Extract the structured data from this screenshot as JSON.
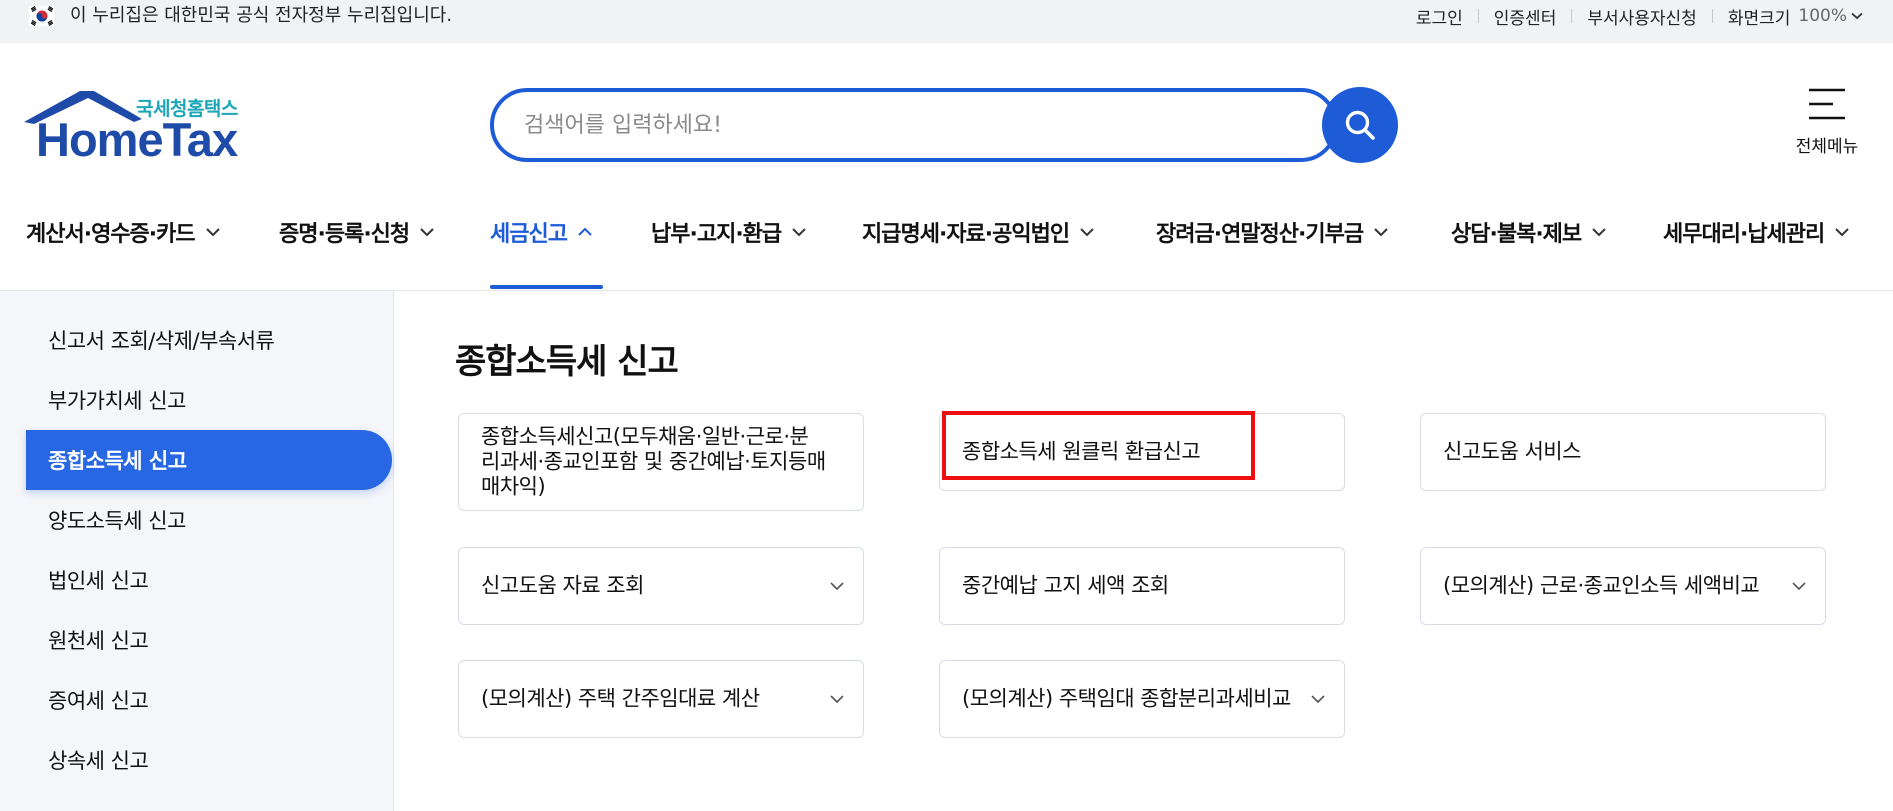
{
  "gov_banner": {
    "text": "이 누리집은 대한민국 공식 전자정부 누리집입니다.",
    "flag_icon": "korea-flag-icon",
    "links": [
      "로그인",
      "인증센터",
      "부서사용자신청"
    ],
    "zoom_label": "화면크기",
    "zoom_value": "100%"
  },
  "header": {
    "logo_sub": "국세청홈택스",
    "logo_main": "HomeTax",
    "search_placeholder": "검색어를 입력하세요!",
    "search_icon": "search-icon",
    "all_menu_label": "전체메뉴"
  },
  "gnb": {
    "items": [
      {
        "label": "계산서·영수증·카드",
        "active": false
      },
      {
        "label": "증명·등록·신청",
        "active": false
      },
      {
        "label": "세금신고",
        "active": true
      },
      {
        "label": "납부·고지·환급",
        "active": false
      },
      {
        "label": "지급명세·자료·공익법인",
        "active": false
      },
      {
        "label": "장려금·연말정산·기부금",
        "active": false
      },
      {
        "label": "상담·불복·제보",
        "active": false
      },
      {
        "label": "세무대리·납세관리",
        "active": false
      }
    ]
  },
  "sidebar": {
    "items": [
      {
        "label": "신고서 조회/삭제/부속서류",
        "active": false
      },
      {
        "label": "부가가치세 신고",
        "active": false
      },
      {
        "label": "종합소득세 신고",
        "active": true
      },
      {
        "label": "양도소득세 신고",
        "active": false
      },
      {
        "label": "법인세 신고",
        "active": false
      },
      {
        "label": "원천세 신고",
        "active": false
      },
      {
        "label": "증여세 신고",
        "active": false
      },
      {
        "label": "상속세 신고",
        "active": false
      }
    ]
  },
  "content": {
    "title": "종합소득세 신고",
    "cards": [
      {
        "label": "종합소득세신고(모두채움·일반·근로·분리과세·종교인포함 및 중간예납·토지등매매차익)",
        "dropdown": false
      },
      {
        "label": "종합소득세 원클릭 환급신고",
        "dropdown": false,
        "highlighted": true
      },
      {
        "label": "신고도움 서비스",
        "dropdown": false
      },
      {
        "label": "신고도움 자료 조회",
        "dropdown": true
      },
      {
        "label": "중간예납 고지 세액 조회",
        "dropdown": false
      },
      {
        "label": "(모의계산) 근로·종교인소득 세액비교",
        "dropdown": true
      },
      {
        "label": "(모의계산) 주택 간주임대료 계산",
        "dropdown": true
      },
      {
        "label": "(모의계산) 주택임대 종합분리과세비교",
        "dropdown": true
      }
    ]
  },
  "colors": {
    "brand_blue": "#1e5bd7",
    "sidebar_active": "#2767e4",
    "logo_teal": "#1aa6b7",
    "highlight_red": "#ee1010"
  }
}
